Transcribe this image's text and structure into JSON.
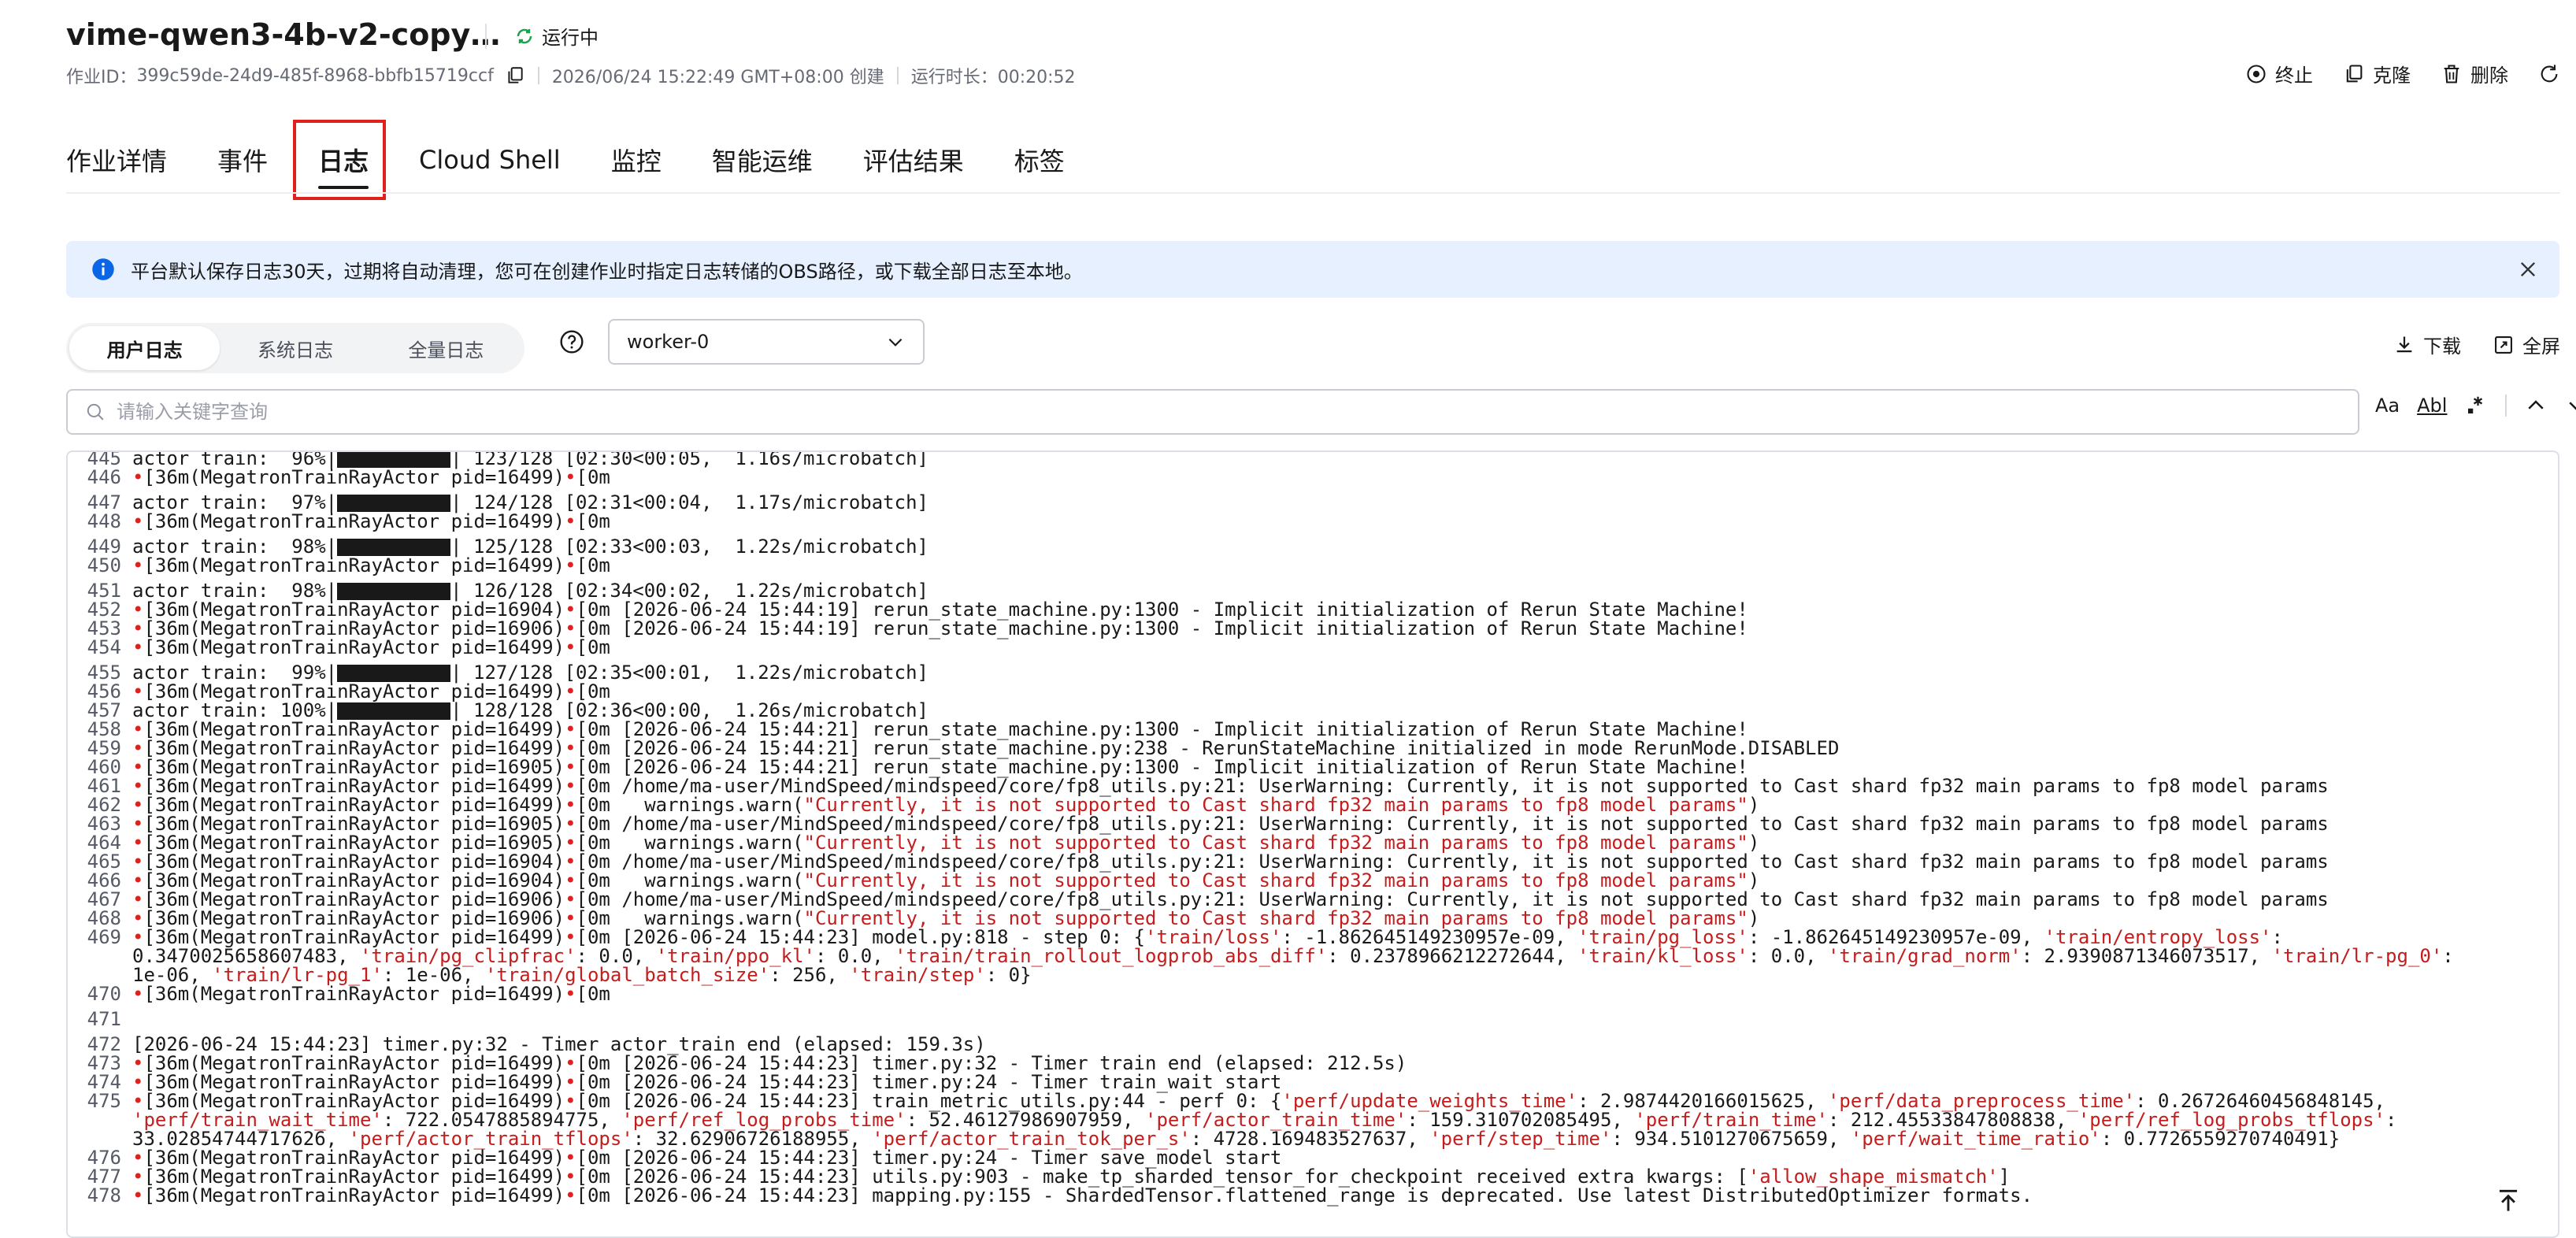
{
  "header": {
    "job_title": "vime-qwen3-4b-v2-copy…",
    "status": "运行中",
    "job_id_label": "作业ID：",
    "job_id": "399c59de-24d9-485f-8968-bbfb15719ccf",
    "created": "2026/06/24 15:22:49 GMT+08:00 创建",
    "duration": "运行时长：00:20:52",
    "actions": {
      "stop": "终止",
      "clone": "克隆",
      "delete": "删除"
    }
  },
  "tabs": [
    {
      "label": "作业详情"
    },
    {
      "label": "事件"
    },
    {
      "label": "日志"
    },
    {
      "label": "Cloud Shell"
    },
    {
      "label": "监控"
    },
    {
      "label": "智能运维"
    },
    {
      "label": "评估结果"
    },
    {
      "label": "标签"
    }
  ],
  "notice": {
    "text": "平台默认保存日志30天，过期将自动清理，您可在创建作业时指定日志转储的OBS路径，或下载全部日志至本地。"
  },
  "log_toolbar": {
    "types": [
      "用户日志",
      "系统日志",
      "全量日志"
    ],
    "worker": "worker-0",
    "download": "下载",
    "fullscreen": "全屏"
  },
  "search": {
    "placeholder": "请输入关键字查询",
    "case_label": "Aa",
    "word_label": "Abl"
  },
  "log_lines": [
    {
      "n": "445",
      "t": "actor train:  96%|",
      "b": true,
      "t2": "| 123/128 [02:30<00:05,  1.16s/microbatch]",
      "gap": false
    },
    {
      "n": "446",
      "d": true,
      "t": "[36m(MegatronTrainRayActor pid=16499)",
      "t3": "[0m"
    },
    {
      "n": "447",
      "t": "actor train:  97%|",
      "b": true,
      "t2": "| 124/128 [02:31<00:04,  1.17s/microbatch]",
      "gap": true
    },
    {
      "n": "448",
      "d": true,
      "t": "[36m(MegatronTrainRayActor pid=16499)",
      "t3": "[0m"
    },
    {
      "n": "449",
      "t": "actor train:  98%|",
      "b": true,
      "t2": "| 125/128 [02:33<00:03,  1.22s/microbatch]",
      "gap": true
    },
    {
      "n": "450",
      "d": true,
      "t": "[36m(MegatronTrainRayActor pid=16499)",
      "t3": "[0m"
    },
    {
      "n": "451",
      "t": "actor train:  98%|",
      "b": true,
      "t2": "| 126/128 [02:34<00:02,  1.22s/microbatch]",
      "gap": true
    },
    {
      "n": "452",
      "d": true,
      "t": "[36m(MegatronTrainRayActor pid=16904)",
      "t3": "[0m [2026-06-24 15:44:19] rerun_state_machine.py:1300 - Implicit initialization of Rerun State Machine!"
    },
    {
      "n": "453",
      "d": true,
      "t": "[36m(MegatronTrainRayActor pid=16906)",
      "t3": "[0m [2026-06-24 15:44:19] rerun_state_machine.py:1300 - Implicit initialization of Rerun State Machine!"
    },
    {
      "n": "454",
      "d": true,
      "t": "[36m(MegatronTrainRayActor pid=16499)",
      "t3": "[0m"
    },
    {
      "n": "455",
      "t": "actor train:  99%|",
      "b": true,
      "t2": "| 127/128 [02:35<00:01,  1.22s/microbatch]",
      "gap": true
    },
    {
      "n": "456",
      "d": true,
      "t": "[36m(MegatronTrainRayActor pid=16499)",
      "t3": "[0m"
    },
    {
      "n": "457",
      "t": "actor train: 100%|",
      "b": true,
      "t2": "| 128/128 [02:36<00:00,  1.26s/microbatch]"
    },
    {
      "n": "458",
      "d": true,
      "t": "[36m(MegatronTrainRayActor pid=16499)",
      "t3": "[0m [2026-06-24 15:44:21] rerun_state_machine.py:1300 - Implicit initialization of Rerun State Machine!"
    },
    {
      "n": "459",
      "d": true,
      "t": "[36m(MegatronTrainRayActor pid=16499)",
      "t3": "[0m [2026-06-24 15:44:21] rerun_state_machine.py:238 - RerunStateMachine initialized in mode RerunMode.DISABLED"
    },
    {
      "n": "460",
      "d": true,
      "t": "[36m(MegatronTrainRayActor pid=16905)",
      "t3": "[0m [2026-06-24 15:44:21] rerun_state_machine.py:1300 - Implicit initialization of Rerun State Machine!"
    },
    {
      "n": "461",
      "d": true,
      "t": "[36m(MegatronTrainRayActor pid=16499)",
      "t3": "[0m /home/ma-user/MindSpeed/mindspeed/core/fp8_utils.py:21: UserWarning: Currently, it is not supported to Cast shard fp32 main params to fp8 model params"
    },
    {
      "n": "462",
      "d": true,
      "t": "[36m(MegatronTrainRayActor pid=16499)",
      "t3": "[0m   warnings.warn(",
      "r": "\"Currently, it is not supported to Cast shard fp32 main params to fp8 model params\"",
      "t4": ")"
    },
    {
      "n": "463",
      "d": true,
      "t": "[36m(MegatronTrainRayActor pid=16905)",
      "t3": "[0m /home/ma-user/MindSpeed/mindspeed/core/fp8_utils.py:21: UserWarning: Currently, it is not supported to Cast shard fp32 main params to fp8 model params"
    },
    {
      "n": "464",
      "d": true,
      "t": "[36m(MegatronTrainRayActor pid=16905)",
      "t3": "[0m   warnings.warn(",
      "r": "\"Currently, it is not supported to Cast shard fp32 main params to fp8 model params\"",
      "t4": ")"
    },
    {
      "n": "465",
      "d": true,
      "t": "[36m(MegatronTrainRayActor pid=16904)",
      "t3": "[0m /home/ma-user/MindSpeed/mindspeed/core/fp8_utils.py:21: UserWarning: Currently, it is not supported to Cast shard fp32 main params to fp8 model params"
    },
    {
      "n": "466",
      "d": true,
      "t": "[36m(MegatronTrainRayActor pid=16904)",
      "t3": "[0m   warnings.warn(",
      "r": "\"Currently, it is not supported to Cast shard fp32 main params to fp8 model params\"",
      "t4": ")"
    },
    {
      "n": "467",
      "d": true,
      "t": "[36m(MegatronTrainRayActor pid=16906)",
      "t3": "[0m /home/ma-user/MindSpeed/mindspeed/core/fp8_utils.py:21: UserWarning: Currently, it is not supported to Cast shard fp32 main params to fp8 model params"
    },
    {
      "n": "468",
      "d": true,
      "t": "[36m(MegatronTrainRayActor pid=16906)",
      "t3": "[0m   warnings.warn(",
      "r": "\"Currently, it is not supported to Cast shard fp32 main params to fp8 model params\"",
      "t4": ")"
    },
    {
      "n": "469",
      "d": true,
      "t": "[36m(MegatronTrainRayActor pid=16499)",
      "t3": "[0m [2026-06-24 15:44:23] model.py:818 - step 0: {",
      "r": "'train/loss'",
      "t4": ": -1.862645149230957e-09, ",
      "r2": "'train/pg_loss'",
      "t5": ": -1.862645149230957e-09, ",
      "r3": "'train/entropy_loss'",
      "t6": ":"
    },
    {
      "n": "",
      "t": "0.3470025658607483, ",
      "r": "'train/pg_clipfrac'",
      "t4": ": 0.0, ",
      "r2": "'train/ppo_kl'",
      "t5": ": 0.0, ",
      "r3": "'train/train_rollout_logprob_abs_diff'",
      "t6": ": 0.2378966212272644, ",
      "r4": "'train/kl_loss'",
      "t7": ": 0.0, ",
      "r5": "'train/grad_norm'",
      "t8": ": 2.9390871346073517, ",
      "r6": "'train/lr-pg_0'",
      "t9": ":"
    },
    {
      "n": "",
      "t": "1e-06, ",
      "r": "'train/lr-pg_1'",
      "t4": ": 1e-06, ",
      "r2": "'train/global_batch_size'",
      "t5": ": 256, ",
      "r3": "'train/step'",
      "t6": ": 0}"
    },
    {
      "n": "470",
      "d": true,
      "t": "[36m(MegatronTrainRayActor pid=16499)",
      "t3": "[0m"
    },
    {
      "n": "471",
      "t": "",
      "gap": true
    },
    {
      "n": "472",
      "t": "[2026-06-24 15:44:23] timer.py:32 - Timer actor_train end (elapsed: 159.3s)",
      "gap": true
    },
    {
      "n": "473",
      "d": true,
      "t": "[36m(MegatronTrainRayActor pid=16499)",
      "t3": "[0m [2026-06-24 15:44:23] timer.py:32 - Timer train end (elapsed: 212.5s)"
    },
    {
      "n": "474",
      "d": true,
      "t": "[36m(MegatronTrainRayActor pid=16499)",
      "t3": "[0m [2026-06-24 15:44:23] timer.py:24 - Timer train_wait start"
    },
    {
      "n": "475",
      "d": true,
      "t": "[36m(MegatronTrainRayActor pid=16499)",
      "t3": "[0m [2026-06-24 15:44:23] train_metric_utils.py:44 - perf 0: {",
      "r": "'perf/update_weights_time'",
      "t4": ": 2.9874420166015625, ",
      "r2": "'perf/data_preprocess_time'",
      "t5": ": 0.26726460456848145,"
    },
    {
      "n": "",
      "t": "",
      "r": "'perf/train_wait_time'",
      "t4": ": 722.0547885894775, ",
      "r2": "'perf/ref_log_probs_time'",
      "t5": ": 52.46127986907959, ",
      "r3": "'perf/actor_train_time'",
      "t6": ": 159.310702085495, ",
      "r4": "'perf/train_time'",
      "t7": ": 212.45533847808838, ",
      "r5": "'perf/ref_log_probs_tflops'",
      "t8": ":"
    },
    {
      "n": "",
      "t": "33.02854744717626, ",
      "r": "'perf/actor_train_tflops'",
      "t4": ": 32.62906726188955, ",
      "r2": "'perf/actor_train_tok_per_s'",
      "t5": ": 4728.169483527637, ",
      "r3": "'perf/step_time'",
      "t6": ": 934.5101270675659, ",
      "r4": "'perf/wait_time_ratio'",
      "t7": ": 0.7726559270740491}"
    },
    {
      "n": "476",
      "d": true,
      "t": "[36m(MegatronTrainRayActor pid=16499)",
      "t3": "[0m [2026-06-24 15:44:23] timer.py:24 - Timer save_model start"
    },
    {
      "n": "477",
      "d": true,
      "t": "[36m(MegatronTrainRayActor pid=16499)",
      "t3": "[0m [2026-06-24 15:44:23] utils.py:903 - make_tp_sharded_tensor_for_checkpoint received extra kwargs: [",
      "r": "'allow_shape_mismatch'",
      "t4": "]"
    },
    {
      "n": "478",
      "d": true,
      "t": "[36m(MegatronTrainRayActor pid=16499)",
      "t3": "[0m [2026-06-24 15:44:23] mapping.py:155 - ShardedTensor.flattened_range is deprecated. Use latest DistributedOptimizer formats."
    }
  ],
  "colors": {
    "accent": "#0a66e6",
    "highlight": "#e0201c",
    "notice_bg": "#e6f0ff",
    "log_red": "#c41d1d"
  }
}
